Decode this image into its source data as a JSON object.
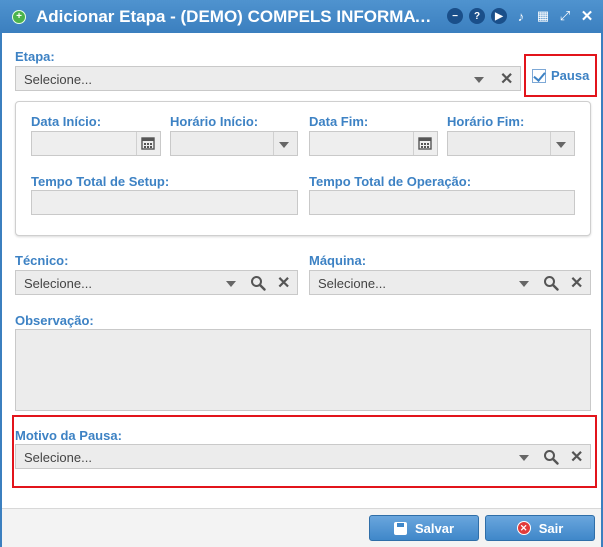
{
  "window": {
    "title": "Adicionar Etapa - (DEMO) COMPELS INFORMATIC...",
    "tools": [
      "minimize-icon",
      "help-icon",
      "play-icon",
      "bell-icon",
      "calendar-icon",
      "maximize-icon",
      "close-icon"
    ]
  },
  "form": {
    "etapa": {
      "label": "Etapa:",
      "placeholder": "Selecione..."
    },
    "pausa": {
      "label": "Pausa",
      "checked": true
    },
    "data_inicio": {
      "label": "Data Início:"
    },
    "horario_inicio": {
      "label": "Horário Início:"
    },
    "data_fim": {
      "label": "Data Fim:"
    },
    "horario_fim": {
      "label": "Horário Fim:"
    },
    "tempo_setup": {
      "label": "Tempo Total de Setup:"
    },
    "tempo_operacao": {
      "label": "Tempo Total de Operação:"
    },
    "tecnico": {
      "label": "Técnico:",
      "placeholder": "Selecione..."
    },
    "maquina": {
      "label": "Máquina:",
      "placeholder": "Selecione..."
    },
    "observacao": {
      "label": "Observação:"
    },
    "motivo_pausa": {
      "label": "Motivo da Pausa:",
      "placeholder": "Selecione..."
    }
  },
  "footer": {
    "salvar_label": "Salvar",
    "sair_label": "Sair"
  },
  "colors": {
    "accent": "#3d82c4",
    "highlight": "#e2141b",
    "titlebar": "#3b7fbf"
  }
}
